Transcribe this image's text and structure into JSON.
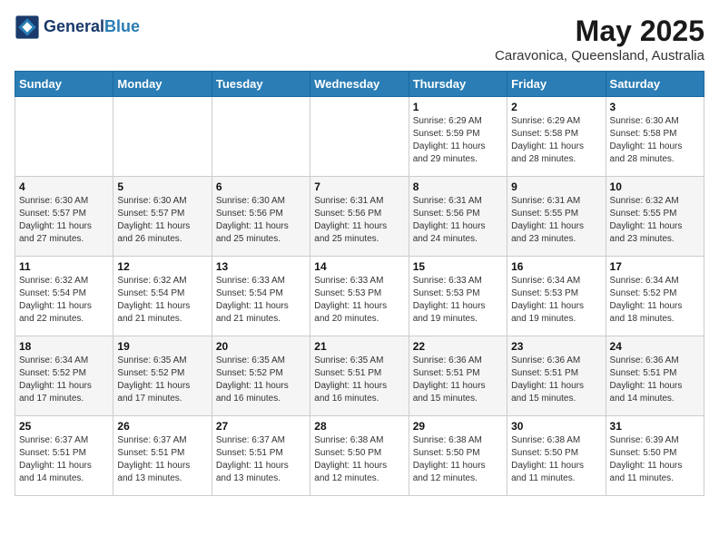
{
  "header": {
    "logo_general": "General",
    "logo_blue": "Blue",
    "month_year": "May 2025",
    "location": "Caravonica, Queensland, Australia"
  },
  "days_of_week": [
    "Sunday",
    "Monday",
    "Tuesday",
    "Wednesday",
    "Thursday",
    "Friday",
    "Saturday"
  ],
  "weeks": [
    [
      {
        "day": "",
        "info": ""
      },
      {
        "day": "",
        "info": ""
      },
      {
        "day": "",
        "info": ""
      },
      {
        "day": "",
        "info": ""
      },
      {
        "day": "1",
        "info": "Sunrise: 6:29 AM\nSunset: 5:59 PM\nDaylight: 11 hours\nand 29 minutes."
      },
      {
        "day": "2",
        "info": "Sunrise: 6:29 AM\nSunset: 5:58 PM\nDaylight: 11 hours\nand 28 minutes."
      },
      {
        "day": "3",
        "info": "Sunrise: 6:30 AM\nSunset: 5:58 PM\nDaylight: 11 hours\nand 28 minutes."
      }
    ],
    [
      {
        "day": "4",
        "info": "Sunrise: 6:30 AM\nSunset: 5:57 PM\nDaylight: 11 hours\nand 27 minutes."
      },
      {
        "day": "5",
        "info": "Sunrise: 6:30 AM\nSunset: 5:57 PM\nDaylight: 11 hours\nand 26 minutes."
      },
      {
        "day": "6",
        "info": "Sunrise: 6:30 AM\nSunset: 5:56 PM\nDaylight: 11 hours\nand 25 minutes."
      },
      {
        "day": "7",
        "info": "Sunrise: 6:31 AM\nSunset: 5:56 PM\nDaylight: 11 hours\nand 25 minutes."
      },
      {
        "day": "8",
        "info": "Sunrise: 6:31 AM\nSunset: 5:56 PM\nDaylight: 11 hours\nand 24 minutes."
      },
      {
        "day": "9",
        "info": "Sunrise: 6:31 AM\nSunset: 5:55 PM\nDaylight: 11 hours\nand 23 minutes."
      },
      {
        "day": "10",
        "info": "Sunrise: 6:32 AM\nSunset: 5:55 PM\nDaylight: 11 hours\nand 23 minutes."
      }
    ],
    [
      {
        "day": "11",
        "info": "Sunrise: 6:32 AM\nSunset: 5:54 PM\nDaylight: 11 hours\nand 22 minutes."
      },
      {
        "day": "12",
        "info": "Sunrise: 6:32 AM\nSunset: 5:54 PM\nDaylight: 11 hours\nand 21 minutes."
      },
      {
        "day": "13",
        "info": "Sunrise: 6:33 AM\nSunset: 5:54 PM\nDaylight: 11 hours\nand 21 minutes."
      },
      {
        "day": "14",
        "info": "Sunrise: 6:33 AM\nSunset: 5:53 PM\nDaylight: 11 hours\nand 20 minutes."
      },
      {
        "day": "15",
        "info": "Sunrise: 6:33 AM\nSunset: 5:53 PM\nDaylight: 11 hours\nand 19 minutes."
      },
      {
        "day": "16",
        "info": "Sunrise: 6:34 AM\nSunset: 5:53 PM\nDaylight: 11 hours\nand 19 minutes."
      },
      {
        "day": "17",
        "info": "Sunrise: 6:34 AM\nSunset: 5:52 PM\nDaylight: 11 hours\nand 18 minutes."
      }
    ],
    [
      {
        "day": "18",
        "info": "Sunrise: 6:34 AM\nSunset: 5:52 PM\nDaylight: 11 hours\nand 17 minutes."
      },
      {
        "day": "19",
        "info": "Sunrise: 6:35 AM\nSunset: 5:52 PM\nDaylight: 11 hours\nand 17 minutes."
      },
      {
        "day": "20",
        "info": "Sunrise: 6:35 AM\nSunset: 5:52 PM\nDaylight: 11 hours\nand 16 minutes."
      },
      {
        "day": "21",
        "info": "Sunrise: 6:35 AM\nSunset: 5:51 PM\nDaylight: 11 hours\nand 16 minutes."
      },
      {
        "day": "22",
        "info": "Sunrise: 6:36 AM\nSunset: 5:51 PM\nDaylight: 11 hours\nand 15 minutes."
      },
      {
        "day": "23",
        "info": "Sunrise: 6:36 AM\nSunset: 5:51 PM\nDaylight: 11 hours\nand 15 minutes."
      },
      {
        "day": "24",
        "info": "Sunrise: 6:36 AM\nSunset: 5:51 PM\nDaylight: 11 hours\nand 14 minutes."
      }
    ],
    [
      {
        "day": "25",
        "info": "Sunrise: 6:37 AM\nSunset: 5:51 PM\nDaylight: 11 hours\nand 14 minutes."
      },
      {
        "day": "26",
        "info": "Sunrise: 6:37 AM\nSunset: 5:51 PM\nDaylight: 11 hours\nand 13 minutes."
      },
      {
        "day": "27",
        "info": "Sunrise: 6:37 AM\nSunset: 5:51 PM\nDaylight: 11 hours\nand 13 minutes."
      },
      {
        "day": "28",
        "info": "Sunrise: 6:38 AM\nSunset: 5:50 PM\nDaylight: 11 hours\nand 12 minutes."
      },
      {
        "day": "29",
        "info": "Sunrise: 6:38 AM\nSunset: 5:50 PM\nDaylight: 11 hours\nand 12 minutes."
      },
      {
        "day": "30",
        "info": "Sunrise: 6:38 AM\nSunset: 5:50 PM\nDaylight: 11 hours\nand 11 minutes."
      },
      {
        "day": "31",
        "info": "Sunrise: 6:39 AM\nSunset: 5:50 PM\nDaylight: 11 hours\nand 11 minutes."
      }
    ]
  ]
}
